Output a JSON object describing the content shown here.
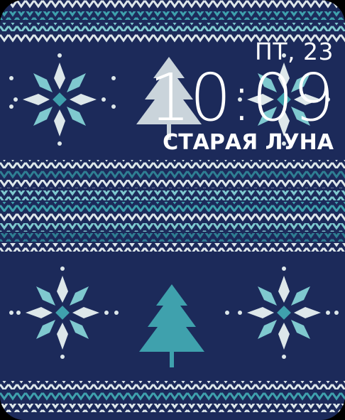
{
  "watchface": {
    "date": "ПТ, 23",
    "time": "10:09",
    "moon_phase": "СТАРАЯ ЛУНА"
  },
  "colors": {
    "background": "#1c2a5a",
    "knit_white": "#dde7ea",
    "knit_light_teal": "#7fc9cf",
    "knit_teal": "#3fa1ad",
    "knit_dark_teal": "#2f7f93",
    "text": "#ffffff"
  }
}
